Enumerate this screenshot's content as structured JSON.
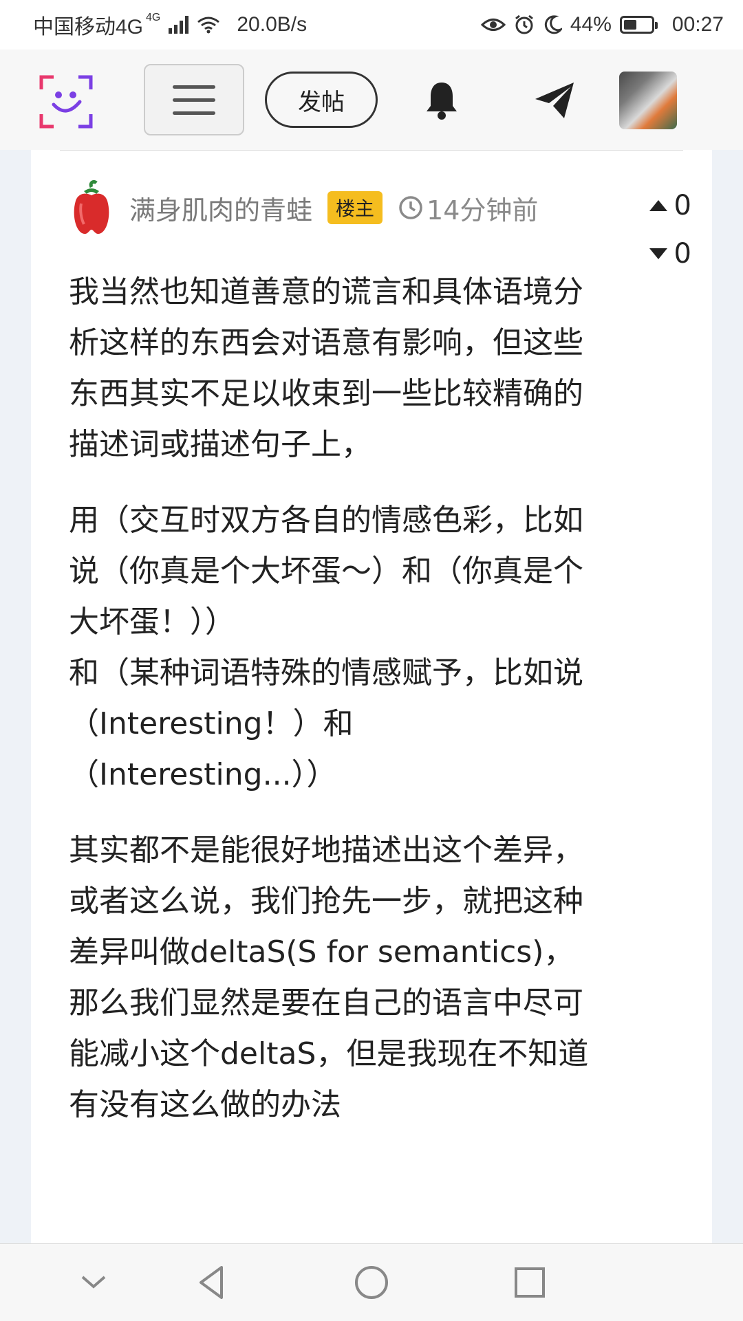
{
  "status_bar": {
    "carrier": "中国移动4G",
    "network_badge": "4G",
    "speed": "20.0B/s",
    "battery": "44%",
    "time": "00:27",
    "battery_level": 0.44
  },
  "header": {
    "post_button_label": "发帖",
    "icons": [
      "app-logo-icon",
      "menu-icon",
      "bell-icon",
      "send-icon",
      "avatar"
    ]
  },
  "post": {
    "author": "满身肌肉的青蛙",
    "badge": "楼主",
    "timestamp": "14分钟前",
    "upvotes": "0",
    "downvotes": "0",
    "paragraphs": [
      "我当然也知道善意的谎言和具体语境分析这样的东西会对语意有影响，但这些东西其实不足以收束到一些比较精确的描述词或描述句子上，",
      "用（交互时双方各自的情感色彩，比如说（你真是个大坏蛋～）和（你真是个大坏蛋！））\n和（某种词语特殊的情感赋予，比如说（Interesting！）和（Interesting...））",
      "其实都不是能很好地描述出这个差异，或者这么说，我们抢先一步，就把这种差异叫做deltaS(S for semantics)，那么我们显然是要在自己的语言中尽可能减小这个deltaS，但是我现在不知道有没有这么做的办法"
    ]
  },
  "colors": {
    "badge_bg": "#f5bd1f",
    "page_bg": "#eef2f7",
    "logo_purple": "#7b3fe4",
    "logo_pink": "#e8386d"
  }
}
